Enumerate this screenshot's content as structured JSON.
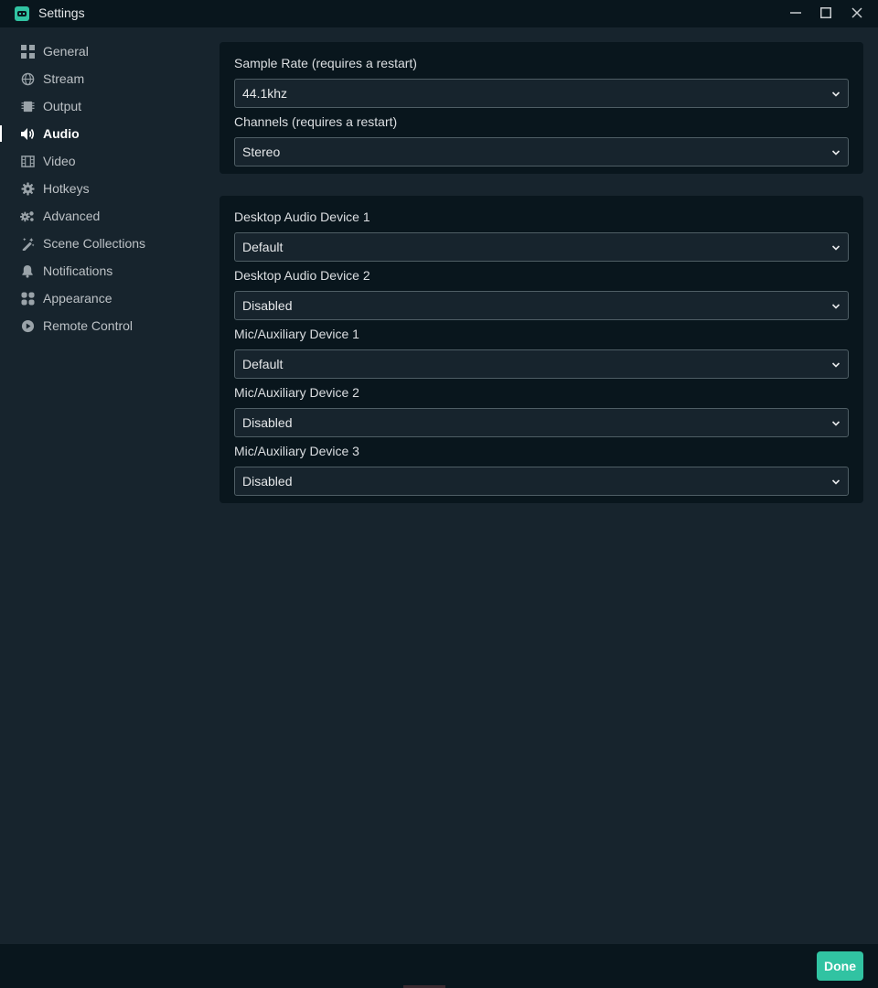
{
  "window": {
    "title": "Settings",
    "icons": {
      "app": "streamlabs-logo-icon",
      "minimize": "minimize-icon",
      "maximize": "maximize-icon",
      "close": "close-icon"
    }
  },
  "sidebar": {
    "items": [
      {
        "label": "General",
        "icon": "grid-icon"
      },
      {
        "label": "Stream",
        "icon": "globe-icon"
      },
      {
        "label": "Output",
        "icon": "chip-icon"
      },
      {
        "label": "Audio",
        "icon": "speaker-icon",
        "active": true
      },
      {
        "label": "Video",
        "icon": "film-icon"
      },
      {
        "label": "Hotkeys",
        "icon": "gear-icon"
      },
      {
        "label": "Advanced",
        "icon": "gears-icon"
      },
      {
        "label": "Scene Collections",
        "icon": "magic-wand-icon"
      },
      {
        "label": "Notifications",
        "icon": "bell-icon"
      },
      {
        "label": "Appearance",
        "icon": "palette-icon"
      },
      {
        "label": "Remote Control",
        "icon": "play-circle-icon"
      }
    ]
  },
  "audio": {
    "sample_rate": {
      "label": "Sample Rate (requires a restart)",
      "value": "44.1khz"
    },
    "channels": {
      "label": "Channels (requires a restart)",
      "value": "Stereo"
    },
    "desktop_audio_1": {
      "label": "Desktop Audio Device 1",
      "value": "Default"
    },
    "desktop_audio_2": {
      "label": "Desktop Audio Device 2",
      "value": "Disabled"
    },
    "mic_aux_1": {
      "label": "Mic/Auxiliary Device 1",
      "value": "Default"
    },
    "mic_aux_2": {
      "label": "Mic/Auxiliary Device 2",
      "value": "Disabled"
    },
    "mic_aux_3": {
      "label": "Mic/Auxiliary Device 3",
      "value": "Disabled"
    }
  },
  "footer": {
    "done_label": "Done"
  },
  "colors": {
    "background": "#17242d",
    "panel": "#09161d",
    "accent": "#31c3a2",
    "text": "#dcdfe2",
    "muted_text": "#bdc2c6",
    "border": "#4f5e65"
  }
}
